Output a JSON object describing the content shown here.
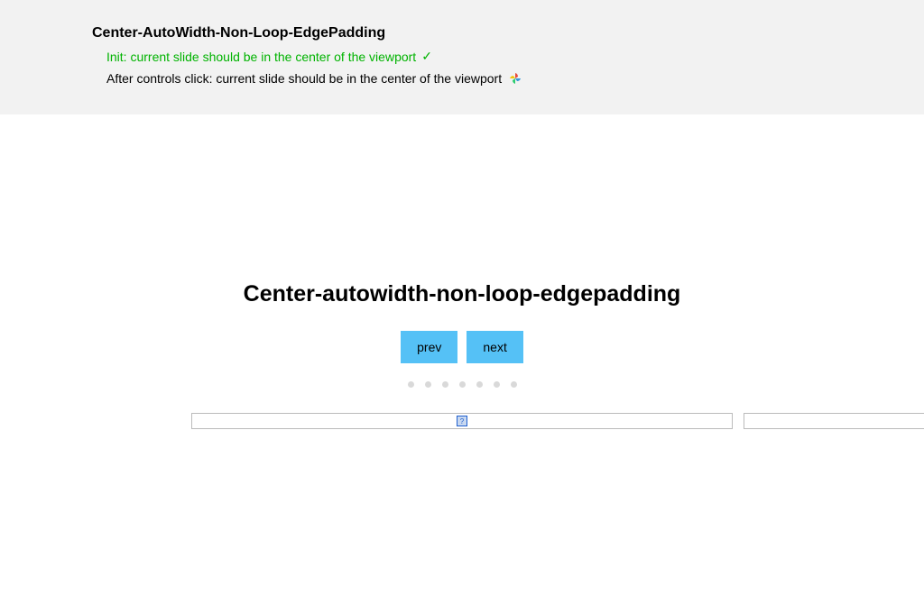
{
  "header": {
    "title": "Center-AutoWidth-Non-Loop-EdgePadding",
    "tests": [
      {
        "text": "Init: current slide should be in the center of the viewport",
        "status": "pass"
      },
      {
        "text": "After controls click: current slide should be in the center of the viewport",
        "status": "running"
      }
    ]
  },
  "main": {
    "title": "Center-autowidth-non-loop-edgepadding",
    "prev_label": "prev",
    "next_label": "next",
    "dot_count": 7,
    "placeholder_glyph": "?"
  },
  "colors": {
    "header_bg": "#f2f2f2",
    "button_bg": "#55c1f6",
    "pass_green": "#00b300",
    "dot_gray": "#d9d9d9"
  }
}
